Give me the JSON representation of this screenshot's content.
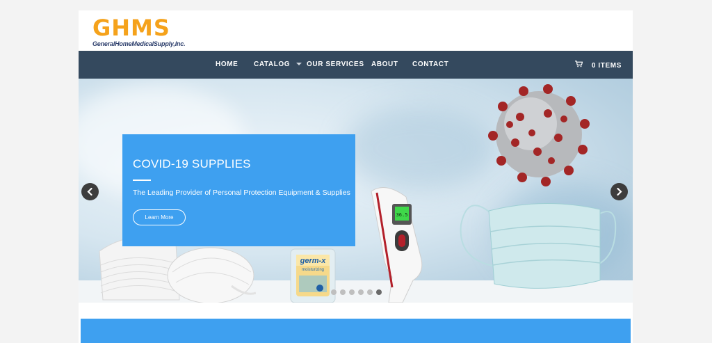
{
  "logo": {
    "main": "GHMS",
    "sub": "GeneralHomeMedicalSupply,Inc."
  },
  "nav": {
    "items": [
      {
        "label": "HOME"
      },
      {
        "label": "CATALOG",
        "has_dropdown": true
      },
      {
        "label": "OUR SERVICES"
      },
      {
        "label": "ABOUT"
      },
      {
        "label": "CONTACT"
      }
    ],
    "cart_label": "0 ITEMS"
  },
  "slide": {
    "title": "COVID-19 SUPPLIES",
    "text": "The Leading Provider of Personal Protection Equipment & Supplies",
    "button": "Learn More",
    "product_labels": {
      "sanitizer_brand": "germ-x",
      "sanitizer_line": "moisturizing",
      "thermometer_reading": "36.5"
    }
  },
  "slider": {
    "total_slides": 6,
    "active_slide": 6
  },
  "colors": {
    "nav_bg": "#34495e",
    "accent_blue": "#3ea0f0",
    "logo_orange": "#f5a21b",
    "logo_navy": "#2b3d6b",
    "virus_red": "#a32626"
  },
  "icons": {
    "cart": "cart-icon",
    "prev": "chevron-left-icon",
    "next": "chevron-right-icon",
    "dropdown": "caret-down-icon"
  }
}
